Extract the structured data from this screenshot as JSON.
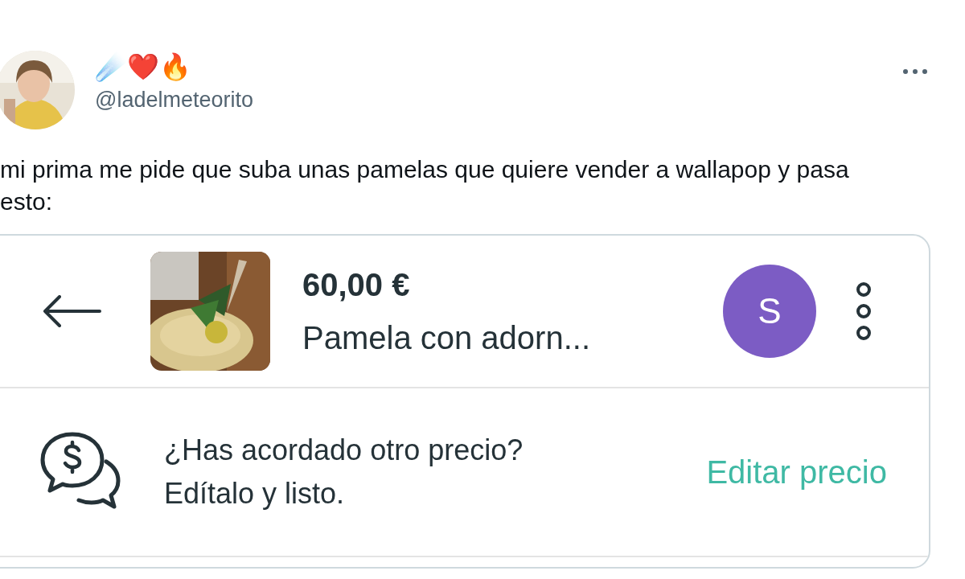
{
  "tweet": {
    "author_emoji": "☄️❤️🔥",
    "handle": "@ladelmeteorito",
    "text": "mi prima me pide que suba unas pamelas que quiere vender a wallapop y pasa esto:"
  },
  "listing": {
    "price": "60,00 €",
    "title": "Pamela con adorn...",
    "seller_initial": "S",
    "prompt_lines": [
      "¿Has acordado otro precio?",
      "Edítalo y listo."
    ],
    "action": "Editar precio"
  }
}
